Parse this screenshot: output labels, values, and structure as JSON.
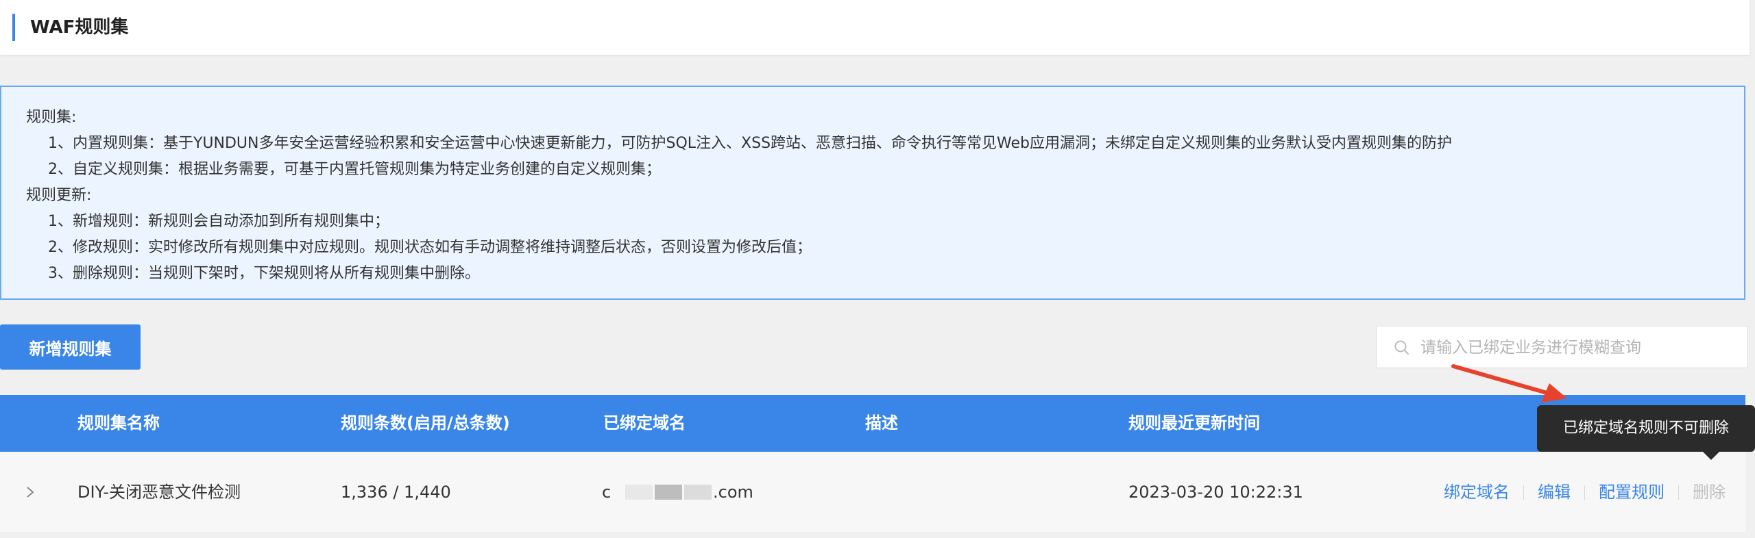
{
  "header": {
    "title": "WAF规则集"
  },
  "notice": {
    "lines": [
      "规则集:",
      "1、内置规则集：基于YUNDUN多年安全运营经验积累和安全运营中心快速更新能力，可防护SQL注入、XSS跨站、恶意扫描、命令执行等常见Web应用漏洞；未绑定自定义规则集的业务默认受内置规则集的防护",
      "2、自定义规则集：根据业务需要，可基于内置托管规则集为特定业务创建的自定义规则集；",
      "规则更新:",
      "1、新增规则：新规则会自动添加到所有规则集中；",
      "2、修改规则：实时修改所有规则集中对应规则。规则状态如有手动调整将维持调整后状态，否则设置为修改后值；",
      "3、删除规则：当规则下架时，下架规则将从所有规则集中删除。"
    ]
  },
  "toolbar": {
    "add_label": "新增规则集",
    "search_placeholder": "请输入已绑定业务进行模糊查询"
  },
  "table": {
    "columns": [
      "规则集名称",
      "规则条数(启用/总条数)",
      "已绑定域名",
      "描述",
      "规则最近更新时间"
    ],
    "rows": [
      {
        "name": "DIY-关闭恶意文件检测",
        "count": "1,336 / 1,440",
        "domain_prefix": "c",
        "domain_suffix": ".com",
        "desc": "",
        "updated": "2023-03-20 10:22:31",
        "actions": {
          "bind": "绑定域名",
          "edit": "编辑",
          "config": "配置规则",
          "delete": "删除"
        }
      }
    ]
  },
  "tooltip": {
    "text": "已绑定域名规则不可删除"
  },
  "colors": {
    "primary": "#3a86e8",
    "notice_bg": "#ecf5ff",
    "tooltip_bg": "#2b2b2b",
    "annotation": "#e8412e"
  }
}
